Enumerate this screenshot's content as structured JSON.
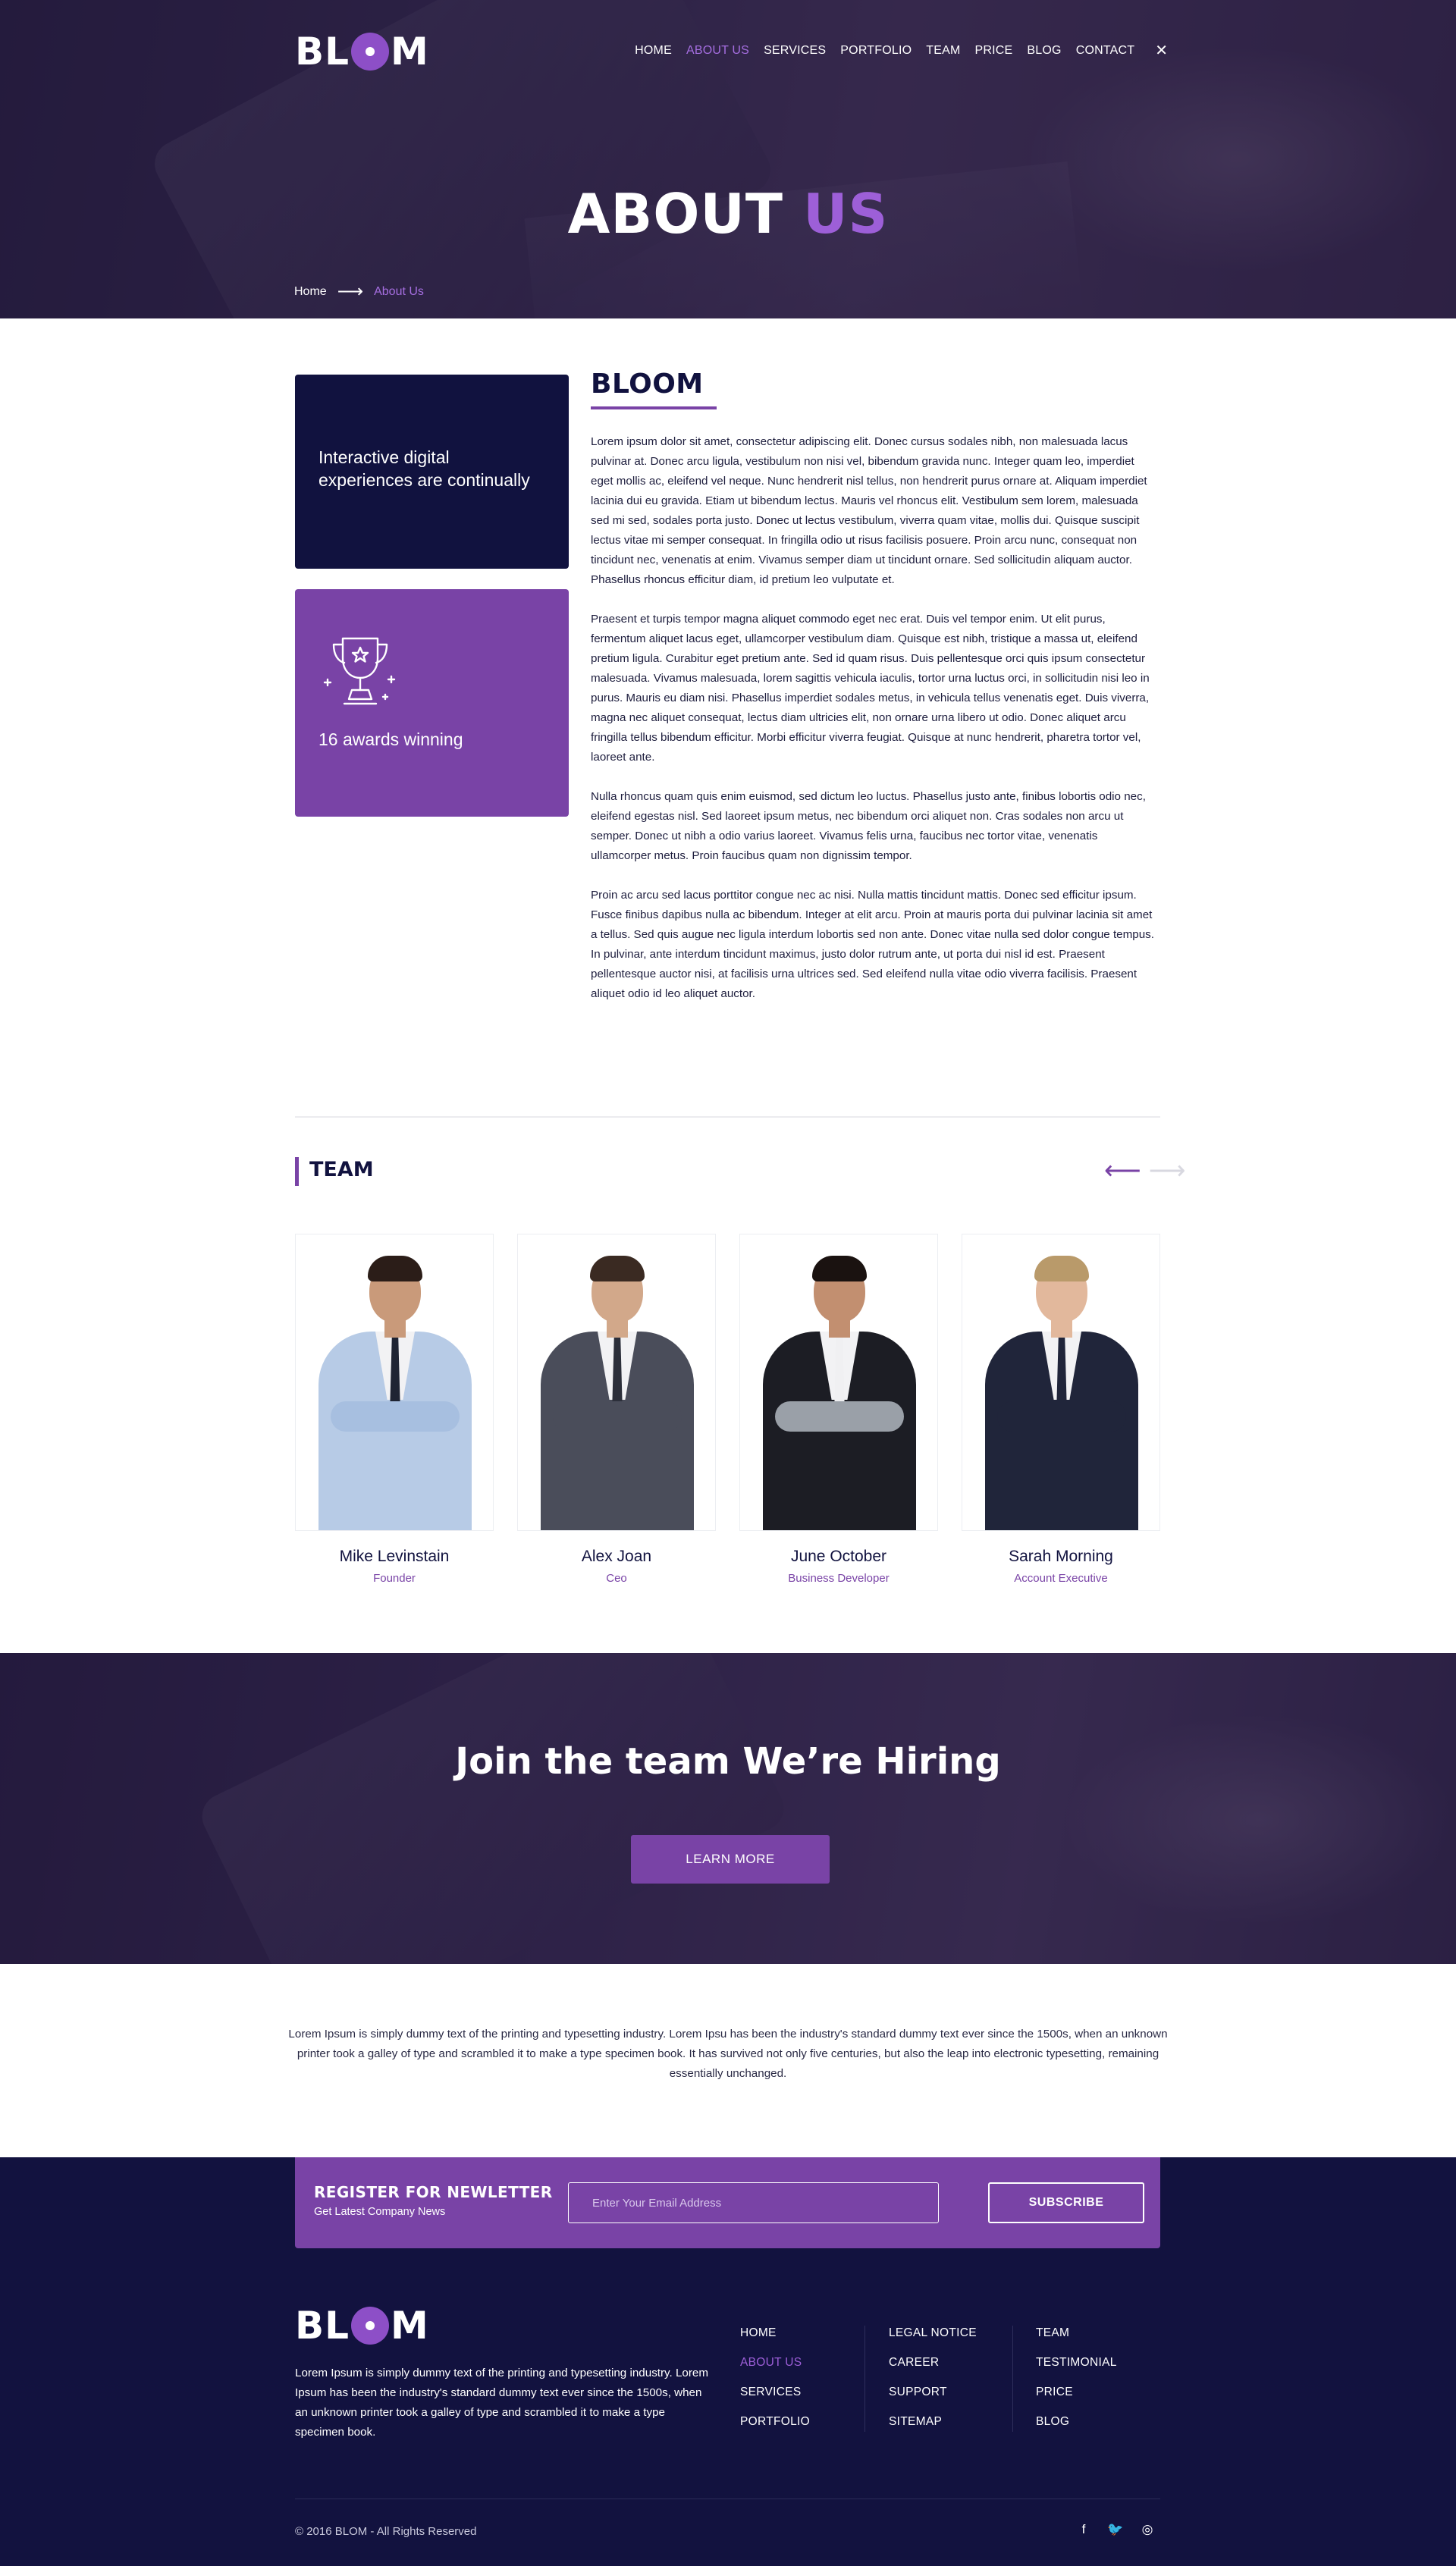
{
  "brand": {
    "logo_pre": "BL",
    "logo_post": "M"
  },
  "nav": {
    "items": [
      "HOME",
      "ABOUT US",
      "SERVICES",
      "PORTFOLIO",
      "TEAM",
      "PRICE",
      "BLOG",
      "CONTACT"
    ],
    "active": "ABOUT US",
    "close_glyph": "✕"
  },
  "hero": {
    "title_main": "ABOUT",
    "title_accent": "US"
  },
  "breadcrumb": {
    "home": "Home",
    "arrow": "⟶",
    "current": "About Us"
  },
  "cards": {
    "digital": "Interactive digital experiences are continually",
    "awards": "16 awards winning",
    "awards_icon": "trophy-icon"
  },
  "about": {
    "title": "BLOOM",
    "paragraphs": [
      "Lorem ipsum dolor sit amet, consectetur adipiscing elit. Donec cursus sodales nibh, non malesuada lacus pulvinar at. Donec arcu ligula, vestibulum non nisi vel, bibendum gravida nunc. Integer quam leo, imperdiet eget mollis ac, eleifend vel neque. Nunc hendrerit nisl tellus, non hendrerit purus ornare at. Aliquam imperdiet lacinia dui eu gravida. Etiam ut bibendum lectus. Mauris vel rhoncus elit. Vestibulum sem lorem, malesuada sed mi sed, sodales porta justo. Donec ut lectus vestibulum, viverra quam vitae, mollis dui. Quisque suscipit lectus vitae mi semper consequat. In fringilla odio ut risus facilisis posuere. Proin arcu nunc, consequat non tincidunt nec, venenatis at enim. Vivamus semper diam ut tincidunt ornare. Sed sollicitudin aliquam auctor. Phasellus rhoncus efficitur diam, id pretium leo vulputate et.",
      "Praesent et turpis tempor magna aliquet commodo eget nec erat. Duis vel tempor enim. Ut elit purus, fermentum aliquet lacus eget, ullamcorper vestibulum diam. Quisque est nibh, tristique a massa ut, eleifend pretium ligula. Curabitur eget pretium ante. Sed id quam risus. Duis pellentesque orci quis ipsum consectetur malesuada. Vivamus malesuada, lorem sagittis vehicula iaculis, tortor urna luctus orci, in sollicitudin nisi leo in purus. Mauris eu diam nisi. Phasellus imperdiet sodales metus, in vehicula tellus venenatis eget. Duis viverra, magna nec aliquet consequat, lectus diam ultricies elit, non ornare urna libero ut odio. Donec aliquet arcu fringilla tellus bibendum efficitur. Morbi efficitur viverra feugiat. Quisque at nunc hendrerit, pharetra tortor vel, laoreet ante.",
      "Nulla rhoncus quam quis enim euismod, sed dictum leo luctus. Phasellus justo ante, finibus lobortis odio nec, eleifend egestas nisl. Sed laoreet ipsum metus, nec bibendum orci aliquet non. Cras sodales non arcu ut semper. Donec ut nibh a odio varius laoreet. Vivamus felis urna, faucibus nec tortor vitae, venenatis ullamcorper metus. Proin faucibus quam non dignissim tempor.",
      "Proin ac arcu sed lacus porttitor congue nec ac nisi. Nulla mattis tincidunt mattis. Donec sed efficitur ipsum. Fusce finibus dapibus nulla ac bibendum. Integer at elit arcu. Proin at mauris porta dui pulvinar lacinia sit amet a tellus. Sed quis augue nec ligula interdum lobortis sed non ante. Donec vitae nulla sed dolor congue tempus. In pulvinar, ante interdum tincidunt maximus, justo dolor rutrum ante, ut porta dui nisl id est. Praesent pellentesque auctor nisi, at facilisis urna ultrices sed. Sed eleifend nulla vitae odio viverra facilisis. Praesent aliquet odio id leo aliquet auctor."
    ]
  },
  "team": {
    "title": "TEAM",
    "prev_glyph": "⟵",
    "next_glyph": "⟶",
    "members": [
      {
        "name": "Mike Levinstain",
        "role": "Founder"
      },
      {
        "name": "Alex Joan",
        "role": "Ceo"
      },
      {
        "name": "June October",
        "role": "Business Developer"
      },
      {
        "name": "Sarah Morning",
        "role": "Account Executive"
      }
    ]
  },
  "hiring": {
    "title": "Join the team We’re Hiring",
    "button": "LEARN MORE"
  },
  "intro_text": "Lorem Ipsum is simply dummy text of the printing and typesetting industry. Lorem Ipsu has been the industry's standard dummy text ever since the 1500s, when an unknown printer took a galley of type and scrambled it to make a type specimen book. It has survived not only five centuries, but also the leap into electronic typesetting, remaining essentially unchanged.",
  "newsletter": {
    "title": "REGISTER FOR NEWLETTER",
    "subtitle": "Get Latest Company News",
    "placeholder": "Enter Your Email Address",
    "button": "SUBSCRIBE"
  },
  "footer": {
    "text": "Lorem Ipsum is simply dummy text of the printing and typesetting industry. Lorem Ipsum has been the industry's standard dummy text ever since the 1500s, when an unknown printer took a galley of type and scrambled it to make a type specimen book.",
    "col1": [
      "HOME",
      "ABOUT US",
      "SERVICES",
      "PORTFOLIO"
    ],
    "col1_active": "ABOUT US",
    "col2": [
      "LEGAL NOTICE",
      "CAREER",
      "SUPPORT",
      "SITEMAP"
    ],
    "col3": [
      "TEAM",
      "TESTIMONIAL",
      "PRICE",
      "BLOG"
    ],
    "copyright": "© 2016 BLOM - All Rights Reserved",
    "social": [
      {
        "name": "facebook-icon",
        "glyph": "f"
      },
      {
        "name": "twitter-icon",
        "glyph": "🐦"
      },
      {
        "name": "instagram-icon",
        "glyph": "◎"
      }
    ]
  },
  "colors": {
    "accent": "#7943a6",
    "accent_light": "#9d5fd8",
    "navy": "#11123f",
    "footer_bg": "#12123f"
  }
}
